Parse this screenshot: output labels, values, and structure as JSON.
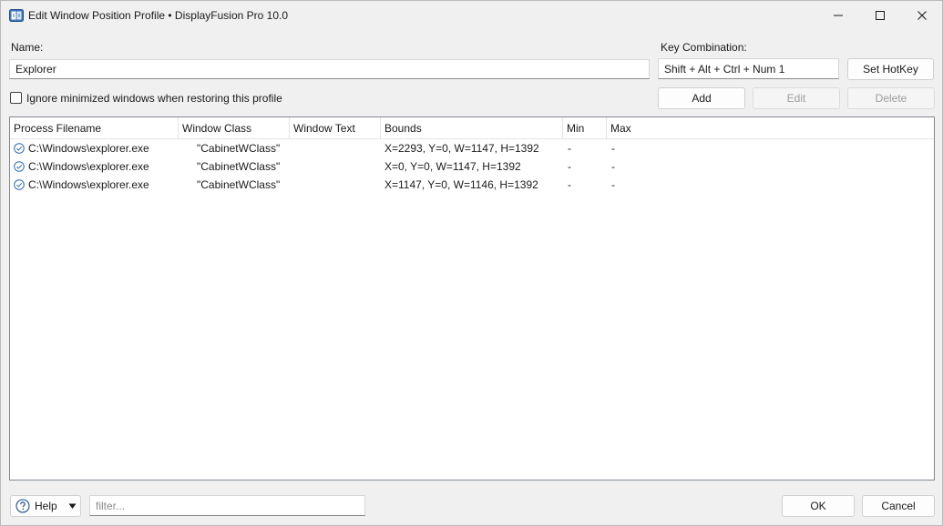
{
  "window": {
    "title": "Edit Window Position Profile • DisplayFusion Pro 10.0",
    "app_icon": "displayfusion-icon",
    "minimize_icon": "minimize-icon",
    "maximize_icon": "maximize-icon",
    "close_icon": "close-icon"
  },
  "form": {
    "name_label": "Name:",
    "name_value": "Explorer",
    "key_label": "Key Combination:",
    "key_value": "Shift + Alt + Ctrl + Num 1",
    "set_hotkey_label": "Set HotKey",
    "ignore_minimized_label": "Ignore minimized windows when restoring this profile",
    "ignore_minimized_checked": false,
    "add_label": "Add",
    "edit_label": "Edit",
    "delete_label": "Delete"
  },
  "grid": {
    "columns": [
      "Process Filename",
      "Window Class",
      "Window Text",
      "Bounds",
      "Min",
      "Max"
    ],
    "rows": [
      {
        "process": "C:\\Windows\\explorer.exe",
        "class": "\"CabinetWClass\"",
        "text": "",
        "bounds": "X=2293, Y=0, W=1147, H=1392",
        "min": "-",
        "max": "-",
        "icon": "check-circle-icon"
      },
      {
        "process": "C:\\Windows\\explorer.exe",
        "class": "\"CabinetWClass\"",
        "text": "",
        "bounds": "X=0, Y=0, W=1147, H=1392",
        "min": "-",
        "max": "-",
        "icon": "check-circle-icon"
      },
      {
        "process": "C:\\Windows\\explorer.exe",
        "class": "\"CabinetWClass\"",
        "text": "",
        "bounds": "X=1147, Y=0, W=1146, H=1392",
        "min": "-",
        "max": "-",
        "icon": "check-circle-icon"
      }
    ]
  },
  "footer": {
    "help_label": "Help",
    "help_icon": "help-icon",
    "filter_placeholder": "filter...",
    "ok_label": "OK",
    "cancel_label": "Cancel"
  },
  "colors": {
    "background": "#f0f0f0",
    "accent": "#2f6db5",
    "disabled_text": "#9d9d9d"
  }
}
